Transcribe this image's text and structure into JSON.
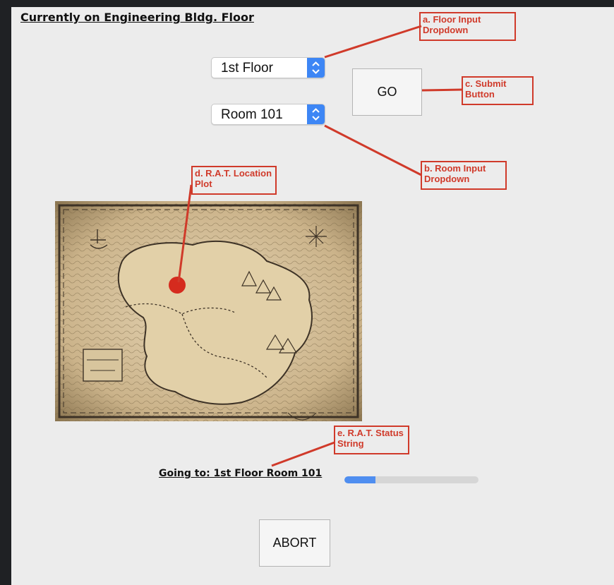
{
  "title": "Currently on Engineering Bldg. Floor",
  "floor_select": {
    "value": "1st Floor"
  },
  "room_select": {
    "value": "Room 101"
  },
  "go_button": {
    "label": "GO"
  },
  "abort_button": {
    "label": "ABORT"
  },
  "status": {
    "text": "Going to: 1st Floor Room 101",
    "progress": 0.23
  },
  "annotations": {
    "a": "a. Floor Input Dropdown",
    "b": "b. Room Input Dropdown",
    "c": "c. Submit Button",
    "d": "d. R.A.T. Location Plot",
    "e": "e. R.A.T. Status String"
  },
  "colors": {
    "annotation": "#d03a2a",
    "accent": "#3d86f5",
    "rat_marker": "#d52b1e"
  }
}
